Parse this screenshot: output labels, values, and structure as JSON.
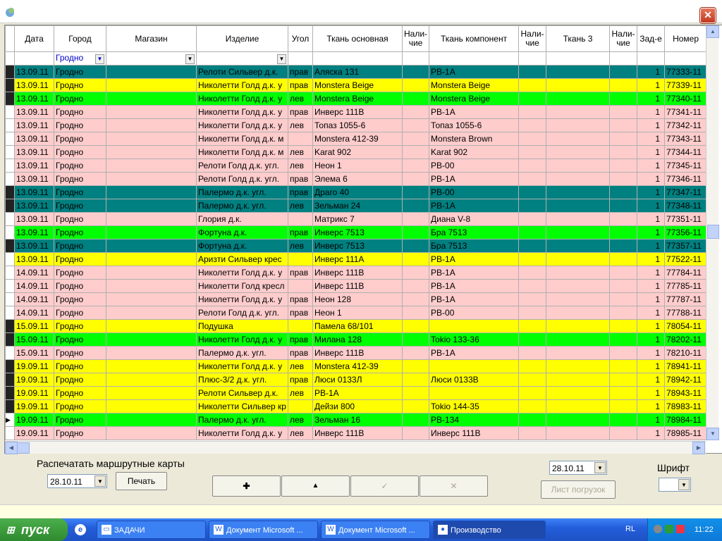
{
  "window": {
    "close_glyph": "✕",
    "icon": "app-icon"
  },
  "table": {
    "headers": [
      "Дата",
      "Город",
      "Магазин",
      "Изделие",
      "Угол",
      "Ткань основная",
      "Нали-\nчие",
      "Ткань компонент",
      "Нали-\nчие",
      "Ткань 3",
      "Нали-\nчие",
      "Зад-е",
      "Номер"
    ],
    "filter": {
      "city": "Гродно"
    },
    "rows": [
      {
        "date": "13.09.11",
        "city": "Гродно",
        "product": "Релоти Сильвер д.к.",
        "angle": "прав",
        "fabric": "Аляска 131",
        "comp": "РВ-1А",
        "qty": "1",
        "num": "77333-11",
        "color": "teal",
        "mark": true
      },
      {
        "date": "13.09.11",
        "city": "Гродно",
        "product": "Николетти Голд д.к. у",
        "angle": "прав",
        "fabric": "Monstera Beige",
        "comp": "Monstera Beige",
        "qty": "1",
        "num": "77339-11",
        "color": "yellow",
        "mark": true
      },
      {
        "date": "13.09.11",
        "city": "Гродно",
        "product": "Николетти Голд д.к. у",
        "angle": "лев",
        "fabric": "Monstera Beige",
        "comp": "Monstera Beige",
        "qty": "1",
        "num": "77340-11",
        "color": "green",
        "mark": true
      },
      {
        "date": "13.09.11",
        "city": "Гродно",
        "product": "Николетти Голд д.к. у",
        "angle": "прав",
        "fabric": "Инверс 111В",
        "comp": "РВ-1А",
        "qty": "1",
        "num": "77341-11",
        "color": "pink",
        "mark": false
      },
      {
        "date": "13.09.11",
        "city": "Гродно",
        "product": "Николетти Голд д.к. у",
        "angle": "лев",
        "fabric": "Топаз 1055-6",
        "comp": "Топаз 1055-6",
        "qty": "1",
        "num": "77342-11",
        "color": "pink",
        "mark": false
      },
      {
        "date": "13.09.11",
        "city": "Гродно",
        "product": "Николетти Голд д.к. м",
        "angle": "",
        "fabric": "Monstera 412-39",
        "comp": "Monstera Brown",
        "qty": "1",
        "num": "77343-11",
        "color": "pink",
        "mark": false
      },
      {
        "date": "13.09.11",
        "city": "Гродно",
        "product": "Николетти Голд д.к. м",
        "angle": "лев",
        "fabric": "Karat 902",
        "comp": "Karat 902",
        "qty": "1",
        "num": "77344-11",
        "color": "pink",
        "mark": false
      },
      {
        "date": "13.09.11",
        "city": "Гродно",
        "product": "Релоти Голд д.к. угл.",
        "angle": "лев",
        "fabric": "Неон 1",
        "comp": "РВ-00",
        "qty": "1",
        "num": "77345-11",
        "color": "pink",
        "mark": false
      },
      {
        "date": "13.09.11",
        "city": "Гродно",
        "product": "Релоти Голд д.к. угл.",
        "angle": "прав",
        "fabric": "Элема 6",
        "comp": "РВ-1А",
        "qty": "1",
        "num": "77346-11",
        "color": "pink",
        "mark": false
      },
      {
        "date": "13.09.11",
        "city": "Гродно",
        "product": "Палермо д.к. угл.",
        "angle": "прав",
        "fabric": "Драго 40",
        "comp": "РВ-00",
        "qty": "1",
        "num": "77347-11",
        "color": "teal",
        "mark": true
      },
      {
        "date": "13.09.11",
        "city": "Гродно",
        "product": "Палермо д.к. угл.",
        "angle": "лев",
        "fabric": "Зельман 24",
        "comp": "РВ-1А",
        "qty": "1",
        "num": "77348-11",
        "color": "teal",
        "mark": true
      },
      {
        "date": "13.09.11",
        "city": "Гродно",
        "product": "Глория д.к.",
        "angle": "",
        "fabric": "Матрикс 7",
        "comp": "Диана V-8",
        "qty": "1",
        "num": "77351-11",
        "color": "pink",
        "mark": false
      },
      {
        "date": "13.09.11",
        "city": "Гродно",
        "product": "Фортуна д.к.",
        "angle": "прав",
        "fabric": "Инверс 7513",
        "comp": "Бра 7513",
        "qty": "1",
        "num": "77356-11",
        "color": "green",
        "mark": false
      },
      {
        "date": "13.09.11",
        "city": "Гродно",
        "product": "Фортуна д.к.",
        "angle": "лев",
        "fabric": "Инверс 7513",
        "comp": "Бра 7513",
        "qty": "1",
        "num": "77357-11",
        "color": "teal",
        "mark": true
      },
      {
        "date": "13.09.11",
        "city": "Гродно",
        "product": "Аризти Сильвер крес",
        "angle": "",
        "fabric": "Инверс 111А",
        "comp": "РВ-1А",
        "qty": "1",
        "num": "77522-11",
        "color": "yellow",
        "mark": false
      },
      {
        "date": "14.09.11",
        "city": "Гродно",
        "product": "Николетти Голд д.к. у",
        "angle": "прав",
        "fabric": "Инверс 111В",
        "comp": "РВ-1А",
        "qty": "1",
        "num": "77784-11",
        "color": "pink",
        "mark": false
      },
      {
        "date": "14.09.11",
        "city": "Гродно",
        "product": "Николетти Голд кресл",
        "angle": "",
        "fabric": "Инверс 111В",
        "comp": "РВ-1А",
        "qty": "1",
        "num": "77785-11",
        "color": "pink",
        "mark": false
      },
      {
        "date": "14.09.11",
        "city": "Гродно",
        "product": "Николетти Голд д.к. у",
        "angle": "прав",
        "fabric": "Неон 128",
        "comp": "РВ-1А",
        "qty": "1",
        "num": "77787-11",
        "color": "pink",
        "mark": false
      },
      {
        "date": "14.09.11",
        "city": "Гродно",
        "product": "Релоти Голд д.к. угл.",
        "angle": "прав",
        "fabric": "Неон 1",
        "comp": "РВ-00",
        "qty": "1",
        "num": "77788-11",
        "color": "pink",
        "mark": false
      },
      {
        "date": "15.09.11",
        "city": "Гродно",
        "product": "Подушка",
        "angle": "",
        "fabric": "Памела 68/101",
        "comp": "",
        "qty": "1",
        "num": "78054-11",
        "color": "yellow",
        "mark": true
      },
      {
        "date": "15.09.11",
        "city": "Гродно",
        "product": "Николетти Голд д.к. у",
        "angle": "прав",
        "fabric": "Милана 128",
        "comp": "Tokio 133-36",
        "qty": "1",
        "num": "78202-11",
        "color": "green",
        "mark": true
      },
      {
        "date": "15.09.11",
        "city": "Гродно",
        "product": "Палермо д.к. угл.",
        "angle": "прав",
        "fabric": "Инверс 111В",
        "comp": "РВ-1А",
        "qty": "1",
        "num": "78210-11",
        "color": "pink",
        "mark": false
      },
      {
        "date": "19.09.11",
        "city": "Гродно",
        "product": "Николетти Голд д.к. у",
        "angle": "лев",
        "fabric": "Monstera 412-39",
        "comp": "",
        "qty": "1",
        "num": "78941-11",
        "color": "yellow",
        "mark": true
      },
      {
        "date": "19.09.11",
        "city": "Гродно",
        "product": "Плюс-3/2 д.к. угл.",
        "angle": "прав",
        "fabric": "Люси 0133Л",
        "comp": "Люси 0133В",
        "qty": "1",
        "num": "78942-11",
        "color": "yellow",
        "mark": true
      },
      {
        "date": "19.09.11",
        "city": "Гродно",
        "product": "Релоти Сильвер д.к.",
        "angle": "лев",
        "fabric": "РВ-1А",
        "comp": "",
        "qty": "1",
        "num": "78943-11",
        "color": "yellow",
        "mark": true
      },
      {
        "date": "19.09.11",
        "city": "Гродно",
        "product": "Николетти Сильвер кр",
        "angle": "",
        "fabric": "Дейзи 800",
        "comp": "Tokio 144-35",
        "qty": "1",
        "num": "78983-11",
        "color": "yellow",
        "mark": true
      },
      {
        "date": "19.09.11",
        "city": "Гродно",
        "product": "Палермо д.к. угл.",
        "angle": "лев",
        "fabric": "Зельман 16",
        "comp": "РВ-134",
        "qty": "1",
        "num": "78984-11",
        "color": "green",
        "mark": "current"
      },
      {
        "date": "19.09.11",
        "city": "Гродно",
        "product": "Николетти Голд д.к. у",
        "angle": "лев",
        "fabric": "Инверс 111В",
        "comp": "Инверс 111В",
        "qty": "1",
        "num": "78985-11",
        "color": "pink",
        "mark": false
      }
    ]
  },
  "colors": {
    "pink": "#FFCCCC",
    "yellow": "#FFFF00",
    "green": "#00FF00",
    "teal": "#008080"
  },
  "bottom": {
    "print_label": "Распечатать маршрутные карты",
    "print_date": "28.10.11",
    "print_button": "Печать",
    "add_glyph": "✚",
    "up_glyph": "▲",
    "check_glyph": "✓",
    "cancel_glyph": "✕",
    "load_date": "28.10.11",
    "load_button": "Лист погрузок",
    "font_label": "Шрифт",
    "font_value": ""
  },
  "taskbar": {
    "start": "пуск",
    "items": [
      {
        "label": "ЗАДАЧИ",
        "icon": "folder-icon"
      },
      {
        "label": "Документ Microsoft ...",
        "icon": "word-icon"
      },
      {
        "label": "Документ Microsoft ...",
        "icon": "word-icon"
      },
      {
        "label": "Производство",
        "icon": "app-icon"
      }
    ],
    "lang": "RL",
    "time": "11:22"
  }
}
